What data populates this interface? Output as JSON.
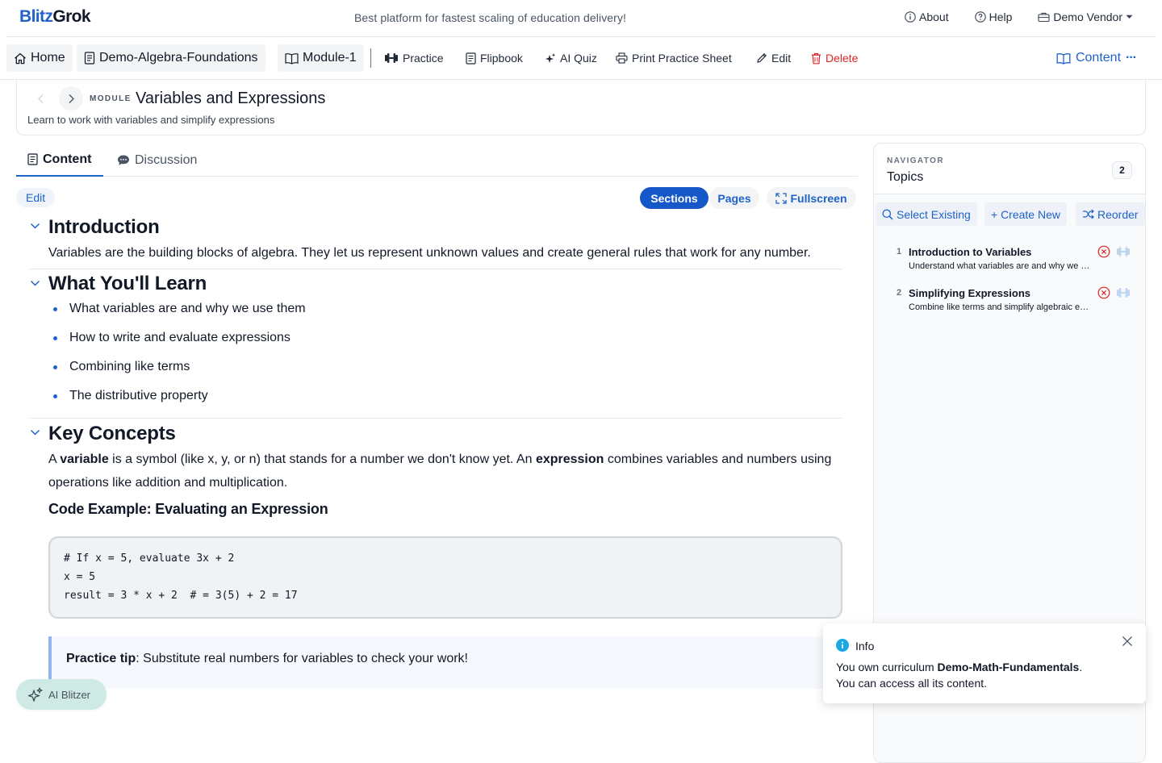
{
  "brand": {
    "logo_part1": "Blitz",
    "logo_part2": "Grok",
    "tagline": "Best platform for fastest scaling of education delivery!"
  },
  "top_links": {
    "about": "About",
    "help": "Help",
    "vendor": "Demo Vendor"
  },
  "breadcrumbs": {
    "home": "Home",
    "curriculum": "Demo-Algebra-Foundations",
    "module": "Module-1"
  },
  "toolbar": {
    "practice": "Practice",
    "flipbook": "Flipbook",
    "ai_quiz": "AI Quiz",
    "print": "Print Practice Sheet",
    "edit": "Edit",
    "delete": "Delete",
    "content_menu": "Content",
    "content_more": "···"
  },
  "module": {
    "kicker": "MODULE",
    "title": "Variables and Expressions",
    "subtitle": "Learn to work with variables and simplify expressions"
  },
  "tabs": {
    "content": "Content",
    "discussion": "Discussion"
  },
  "controls": {
    "edit": "Edit",
    "sections": "Sections",
    "pages": "Pages",
    "fullscreen": "Fullscreen"
  },
  "sections": {
    "intro": {
      "title": "Introduction",
      "text": "Variables are the building blocks of algebra. They let us represent unknown values and create general rules that work for any number."
    },
    "learn": {
      "title": "What You'll Learn",
      "items": [
        "What variables are and why we use them",
        "How to write and evaluate expressions",
        "Combining like terms",
        "The distributive property"
      ]
    },
    "key": {
      "title": "Key Concepts",
      "p_1": "A ",
      "p_variable": "variable",
      "p_2": " is a symbol (like x, y, or n) that stands for a number we don't know yet. An ",
      "p_expression": "expression",
      "p_3": " combines variables and numbers using operations like addition and multiplication.",
      "code_heading": "Code Example: Evaluating an Expression",
      "code_lines": [
        "# If x = 5, evaluate 3x + 2",
        "x = 5",
        "result = 3 * x + 2  # = 3(5) + 2 = 17"
      ],
      "tip_label": "Practice tip",
      "tip_text": ": Substitute real numbers for variables to check your work!"
    }
  },
  "navigator": {
    "kicker": "NAVIGATOR",
    "title": "Topics",
    "count": "2",
    "select_existing": "Select Existing",
    "create_new": "+ Create New",
    "reorder": "Reorder",
    "topics": [
      {
        "num": "1",
        "title": "Introduction to Variables",
        "subtitle": "Understand what variables are and why we use them"
      },
      {
        "num": "2",
        "title": "Simplifying Expressions",
        "subtitle": "Combine like terms and simplify algebraic expressions"
      }
    ]
  },
  "toast": {
    "title": "Info",
    "line1_a": "You own curriculum ",
    "line1_bold": "Demo-Math-Fundamentals",
    "line1_b": ".",
    "line2": "You can access all its content."
  },
  "ai_button": {
    "label": "AI Blitzer"
  },
  "colors": {
    "accent": "#1f62c9",
    "danger": "#dc2626",
    "ai_button_bg": "#cfe9e4"
  }
}
